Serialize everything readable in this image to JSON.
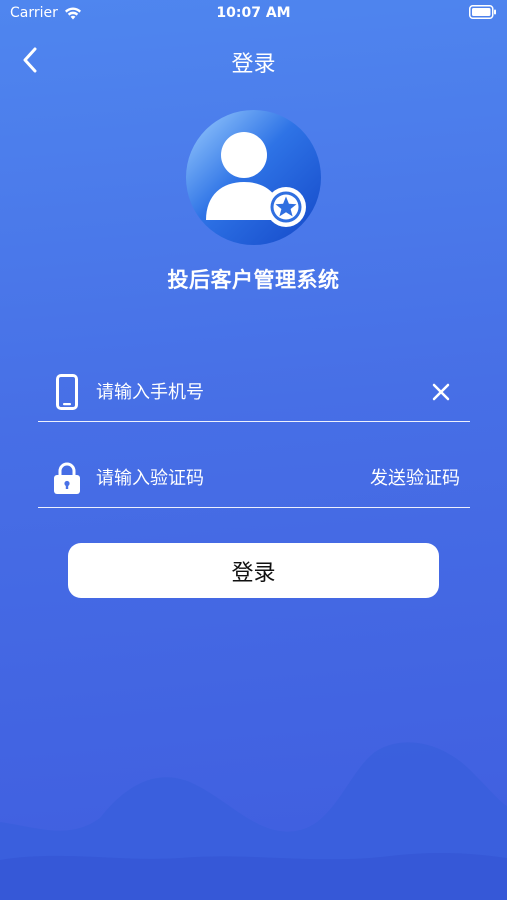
{
  "status_bar": {
    "carrier": "Carrier",
    "time": "10:07 AM",
    "icons": [
      "wifi-icon",
      "battery-icon"
    ]
  },
  "nav": {
    "title": "登录",
    "back_icon": "chevron-left-icon"
  },
  "header": {
    "avatar_icon": "user-star-icon",
    "app_name": "投后客户管理系统"
  },
  "form": {
    "phone": {
      "icon": "phone-icon",
      "value": "",
      "placeholder": "请输入手机号",
      "clear_icon": "close-icon"
    },
    "code": {
      "icon": "lock-icon",
      "value": "",
      "placeholder": "请输入验证码",
      "send_label": "发送验证码"
    },
    "submit_label": "登录"
  },
  "colors": {
    "bg_top": "#4f86ef",
    "bg_bottom": "#3f5ddf",
    "wave": "#3256d6",
    "button_bg": "#ffffff"
  }
}
